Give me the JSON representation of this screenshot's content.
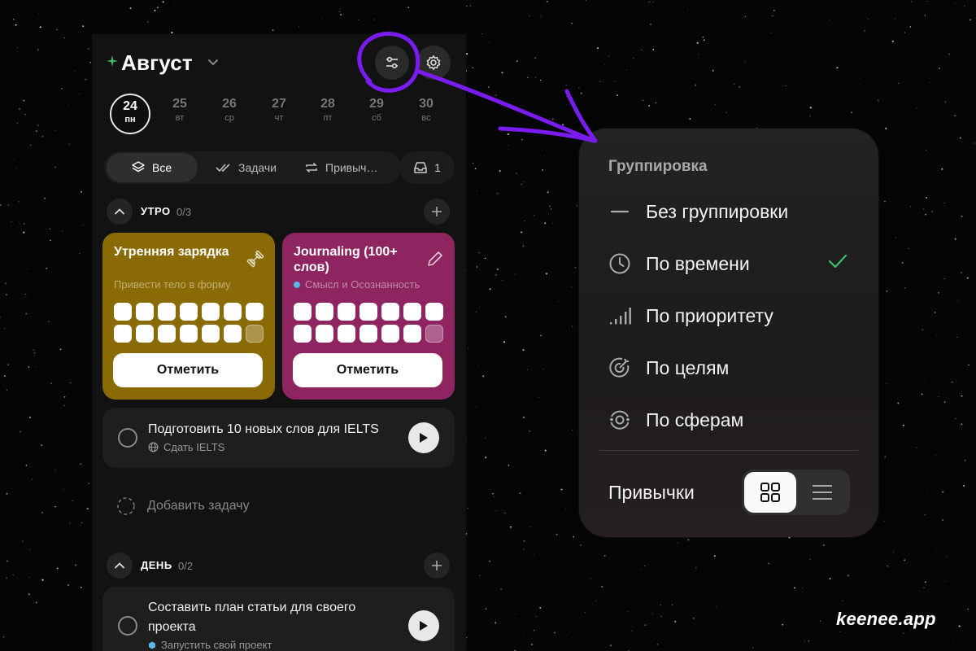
{
  "header": {
    "month": "Август"
  },
  "week": [
    {
      "num": "24",
      "wd": "пн"
    },
    {
      "num": "25",
      "wd": "вт"
    },
    {
      "num": "26",
      "wd": "ср"
    },
    {
      "num": "27",
      "wd": "чт"
    },
    {
      "num": "28",
      "wd": "пт"
    },
    {
      "num": "29",
      "wd": "сб"
    },
    {
      "num": "30",
      "wd": "вс"
    }
  ],
  "tabs": {
    "all": "Все",
    "tasks": "Задачи",
    "habits": "Привыч…",
    "inbox_count": "1"
  },
  "morning": {
    "title": "УТРО",
    "count": "0/3",
    "habits": [
      {
        "name": "Утренняя зарядка",
        "subtitle": "Привести тело в форму",
        "button": "Отметить",
        "icon": "dumbbell-icon"
      },
      {
        "name": "Journaling (100+ слов)",
        "subtitle": "Смысл и Осознанность",
        "button": "Отметить",
        "icon": "pencil-icon"
      }
    ],
    "task": {
      "title": "Подготовить 10 новых слов для IELTS",
      "goal": "Сдать IELTS"
    },
    "add_task": "Добавить задачу"
  },
  "day": {
    "title": "ДЕНЬ",
    "count": "0/2",
    "task": {
      "title_line1": "Составить план статьи для своего",
      "title_line2": "проекта",
      "goal": "Запустить свой проект"
    }
  },
  "popover": {
    "title": "Группировка",
    "options": [
      {
        "label": "Без группировки",
        "icon": "minus-icon",
        "selected": false
      },
      {
        "label": "По времени",
        "icon": "clock-icon",
        "selected": true
      },
      {
        "label": "По приоритету",
        "icon": "signal-bars-icon",
        "selected": false
      },
      {
        "label": "По целям",
        "icon": "target-icon",
        "selected": false
      },
      {
        "label": "По сферам",
        "icon": "sphere-icon",
        "selected": false
      }
    ],
    "habits_label": "Привычки",
    "habits_view": "grid"
  },
  "colors": {
    "habit_gold": "#8a6a05",
    "habit_pink": "#8e2460",
    "accent_purple": "#7a1cf0",
    "check_green": "#3fbf6a"
  },
  "brand": "keenee.app"
}
